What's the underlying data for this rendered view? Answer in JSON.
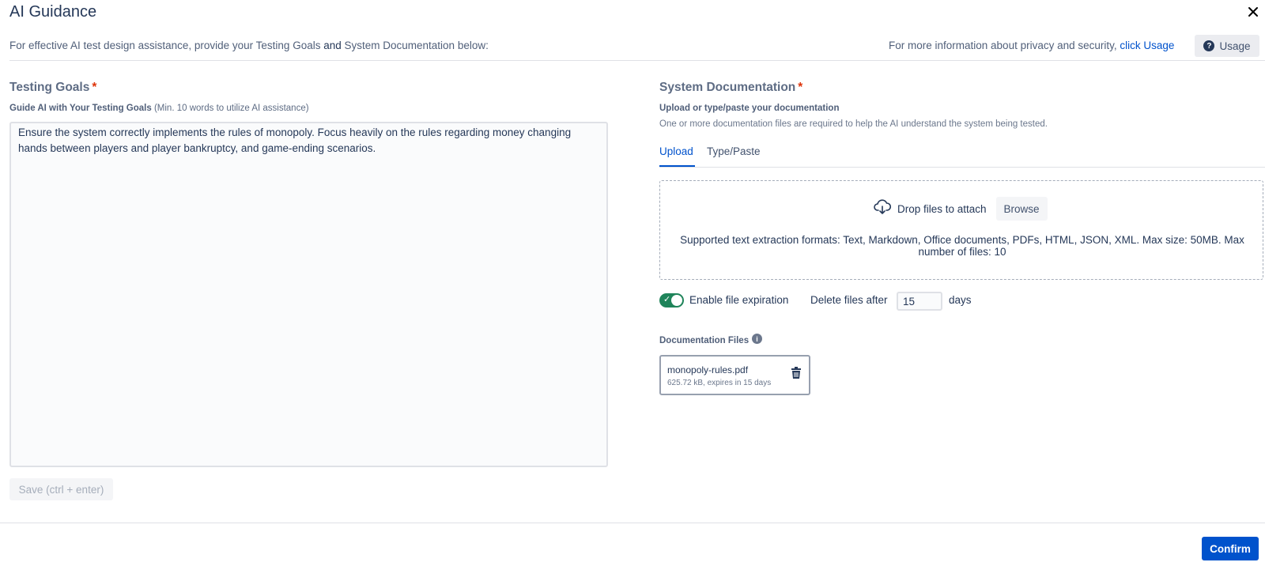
{
  "dialog": {
    "title": "AI Guidance",
    "close_icon": "close-icon"
  },
  "intro": {
    "text_before": "For effective AI test design assistance, provide your Testing Goals ",
    "and": "and",
    "text_after": " System Documentation below:"
  },
  "privacy": {
    "text": "For more information about privacy and security, ",
    "link": "click Usage"
  },
  "usage_button": {
    "label": "Usage",
    "icon": "question-circle-icon"
  },
  "testing_goals": {
    "title": "Testing Goals",
    "required_mark": "*",
    "help_bold": "Guide AI with Your Testing Goals",
    "help_rest": " (Min. 10 words to utilize AI assistance)",
    "value": "Ensure the system correctly implements the rules of monopoly. Focus heavily on the rules regarding money changing hands between players and player bankruptcy, and game-ending scenarios.",
    "save_label": "Save (ctrl + enter)"
  },
  "system_documentation": {
    "title": "System Documentation",
    "required_mark": "*",
    "subtitle": "Upload or type/paste your documentation",
    "help": "One or more documentation files are required to help the AI understand the system being tested.",
    "tabs": [
      {
        "label": "Upload",
        "active": true
      },
      {
        "label": "Type/Paste",
        "active": false
      }
    ],
    "dropzone": {
      "icon": "cloud-upload-icon",
      "drop_text": "Drop files to attach",
      "browse_label": "Browse",
      "formats": "Supported text extraction formats: Text, Markdown, Office documents, PDFs, HTML, JSON, XML. Max size: 50MB. Max number of files: 10"
    },
    "expiration": {
      "toggle_on": true,
      "toggle_label": "Enable file expiration",
      "delete_label": "Delete files after",
      "days_value": "15",
      "days_unit": "days"
    },
    "files_label": "Documentation Files",
    "files": [
      {
        "name": "monopoly-rules.pdf",
        "meta": "625.72 kB, expires in 15 days"
      }
    ]
  },
  "footer": {
    "confirm_label": "Confirm"
  },
  "colors": {
    "primary": "#0052cc",
    "required": "#de350b",
    "toggle_on": "#1f845a"
  }
}
